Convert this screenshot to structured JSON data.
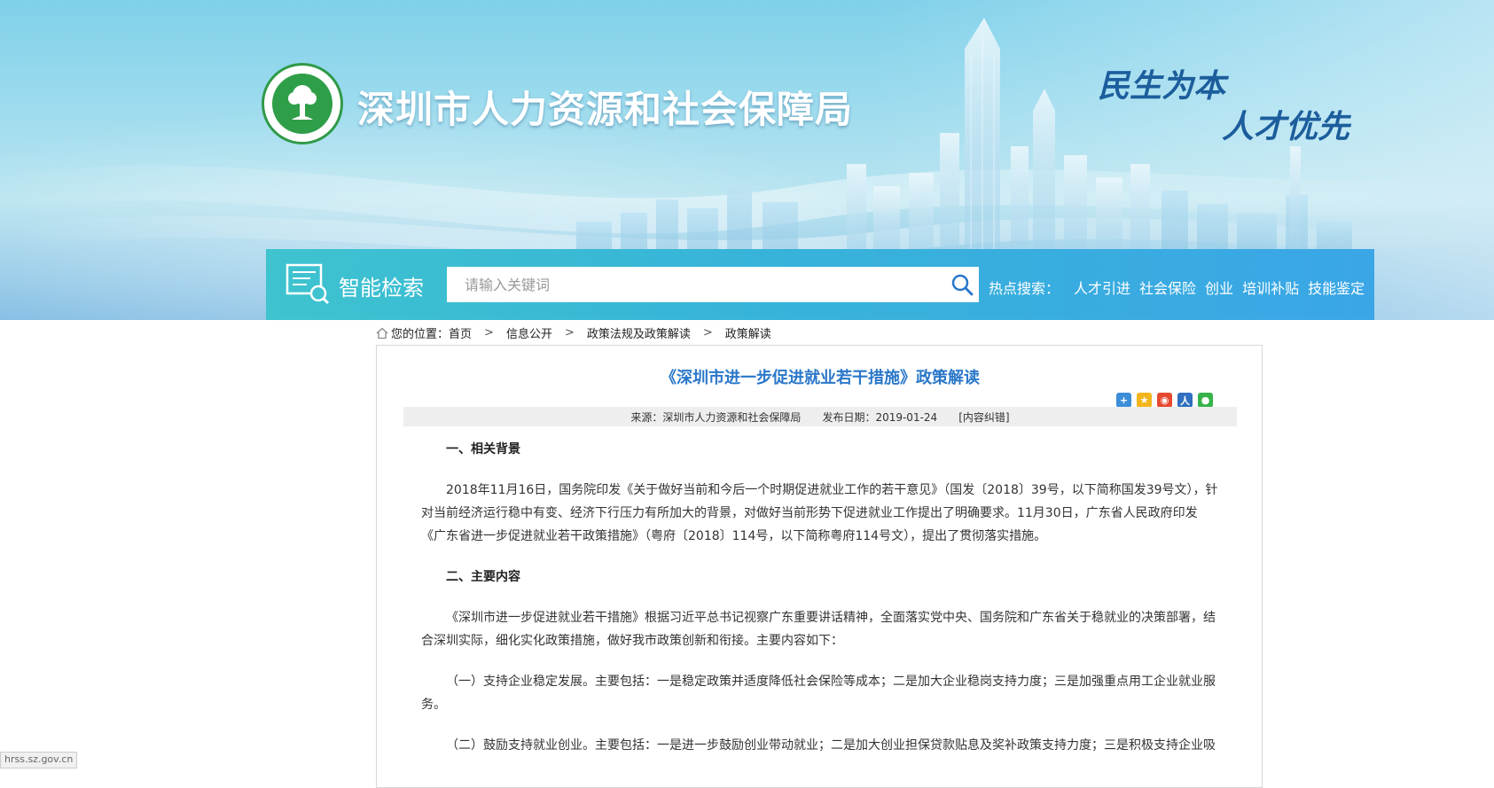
{
  "header": {
    "site_title": "深圳市人力资源和社会保障局",
    "slogan_line1": "民生为本",
    "slogan_line2": "人才优先",
    "logo_icon": "hrss-logo-tree"
  },
  "search": {
    "label": "智能检索",
    "placeholder": "请输入关键词",
    "hot_label": "热点搜索：",
    "hot_terms": [
      "人才引进",
      "社会保险",
      "创业",
      "培训补贴",
      "技能鉴定"
    ]
  },
  "breadcrumb": {
    "prefix": "您的位置：",
    "items": [
      "首页",
      "信息公开",
      "政策法规及政策解读",
      "政策解读"
    ]
  },
  "article": {
    "title": "《深圳市进一步促进就业若干措施》政策解读",
    "source": "来源：深圳市人力资源和社会保障局",
    "date": "发布日期：2019-01-24",
    "correction": "[内容纠错]",
    "share_icons": [
      "share-plus-icon",
      "qzone-icon",
      "weibo-icon",
      "renren-icon",
      "wechat-icon"
    ],
    "sections": [
      {
        "heading": "一、相关背景"
      },
      {
        "paragraph": "2018年11月16日，国务院印发《关于做好当前和今后一个时期促进就业工作的若干意见》（国发〔2018〕39号，以下简称国发39号文），针对当前经济运行稳中有变、经济下行压力有所加大的背景，对做好当前形势下促进就业工作提出了明确要求。11月30日，广东省人民政府印发《广东省进一步促进就业若干政策措施》（粤府〔2018〕114号，以下简称粤府114号文），提出了贯彻落实措施。"
      },
      {
        "heading": "二、主要内容"
      },
      {
        "paragraph": "《深圳市进一步促进就业若干措施》根据习近平总书记视察广东重要讲话精神，全面落实党中央、国务院和广东省关于稳就业的决策部署，结合深圳实际，细化实化政策措施，做好我市政策创新和衔接。主要内容如下："
      },
      {
        "paragraph": "（一）支持企业稳定发展。主要包括：一是稳定政策并适度降低社会保险等成本；二是加大企业稳岗支持力度；三是加强重点用工企业就业服务。"
      },
      {
        "paragraph": "（二）鼓励支持就业创业。主要包括：一是进一步鼓励创业带动就业；二是加大创业担保贷款贴息及奖补政策支持力度；三是积极支持企业吸"
      }
    ]
  },
  "status_bar": {
    "url": "hrss.sz.gov.cn"
  },
  "colors": {
    "title_blue": "#2a77c9",
    "search_bar": "#37b3d9",
    "slogan": "#1c5d9c"
  }
}
